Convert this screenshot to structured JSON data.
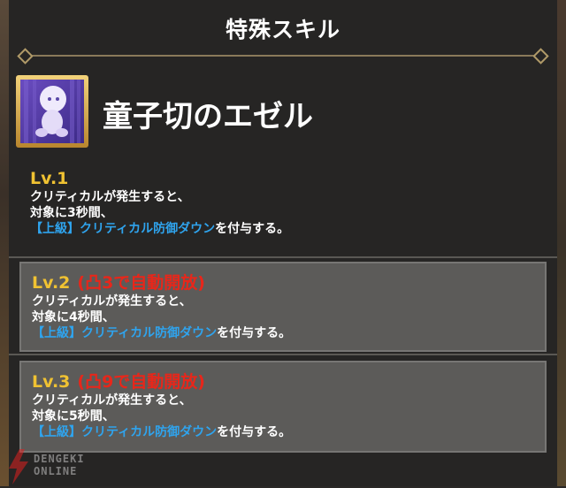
{
  "panel": {
    "title": "特殊スキル"
  },
  "skill": {
    "name": "童子切のエゼル",
    "icon": "purple-character-icon"
  },
  "levels": [
    {
      "level": "Lv.1",
      "unlock": "",
      "line1": "クリティカルが発生すると、",
      "line2": "対象に3秒間、",
      "effect": "【上級】クリティカル防御ダウン",
      "suffix": "を付与する。"
    },
    {
      "level": "Lv.2",
      "unlock": "(凸3で自動開放)",
      "line1": "クリティカルが発生すると、",
      "line2": "対象に4秒間、",
      "effect": "【上級】クリティカル防御ダウン",
      "suffix": "を付与する。"
    },
    {
      "level": "Lv.3",
      "unlock": "(凸9で自動開放)",
      "line1": "クリティカルが発生すると、",
      "line2": "対象に5秒間、",
      "effect": "【上級】クリティカル防御ダウン",
      "suffix": "を付与する。"
    }
  ],
  "watermark": {
    "text1": "DENGEKI",
    "text2": "ONLINE"
  },
  "colors": {
    "level": "#f0c232",
    "unlock": "#e8261a",
    "effect": "#2fa4ee",
    "frame": "#b09a68"
  }
}
